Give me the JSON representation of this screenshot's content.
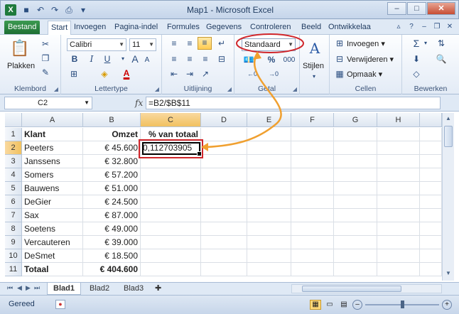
{
  "window": {
    "title": "Map1 - Microsoft Excel"
  },
  "tabs": [
    "Bestand",
    "Start",
    "Invoegen",
    "Pagina-indel",
    "Formules",
    "Gegevens",
    "Controleren",
    "Beeld",
    "Ontwikkelaa"
  ],
  "ribbon": {
    "clipboard": {
      "paste": "Plakken",
      "label": "Klembord"
    },
    "font": {
      "name": "Calibri",
      "size": "11",
      "bold": "B",
      "italic": "I",
      "underline": "U",
      "label": "Lettertype"
    },
    "alignment": {
      "label": "Uitlijning"
    },
    "number": {
      "format": "Standaard",
      "percent": "%",
      "thousands": "000",
      "label": "Getal"
    },
    "styles": {
      "label": "Stijlen"
    },
    "cells": {
      "insert": "Invoegen",
      "delete": "Verwijderen",
      "format": "Opmaak",
      "label": "Cellen"
    },
    "editing": {
      "label": "Bewerken"
    }
  },
  "formula_bar": {
    "name_box": "C2",
    "fx": "fx",
    "formula": "=B2/$B$11"
  },
  "columns": [
    "A",
    "B",
    "C",
    "D",
    "E",
    "F",
    "G",
    "H"
  ],
  "rows": [
    {
      "n": "1",
      "a": "Klant",
      "b": "Omzet",
      "c": "% van totaal"
    },
    {
      "n": "2",
      "a": "Peeters",
      "b": "€ 45.600",
      "c": "0,112703905"
    },
    {
      "n": "3",
      "a": "Janssens",
      "b": "€ 32.800",
      "c": ""
    },
    {
      "n": "4",
      "a": "Somers",
      "b": "€ 57.200",
      "c": ""
    },
    {
      "n": "5",
      "a": "Bauwens",
      "b": "€ 51.000",
      "c": ""
    },
    {
      "n": "6",
      "a": "DeGier",
      "b": "€ 24.500",
      "c": ""
    },
    {
      "n": "7",
      "a": "Sax",
      "b": "€ 87.000",
      "c": ""
    },
    {
      "n": "8",
      "a": "Soetens",
      "b": "€ 49.000",
      "c": ""
    },
    {
      "n": "9",
      "a": "Vercauteren",
      "b": "€ 39.000",
      "c": ""
    },
    {
      "n": "10",
      "a": "DeSmet",
      "b": "€ 18.500",
      "c": ""
    },
    {
      "n": "11",
      "a": "Totaal",
      "b": "€ 404.600",
      "c": ""
    }
  ],
  "sheets": [
    "Blad1",
    "Blad2",
    "Blad3"
  ],
  "status": {
    "text": "Gereed"
  }
}
